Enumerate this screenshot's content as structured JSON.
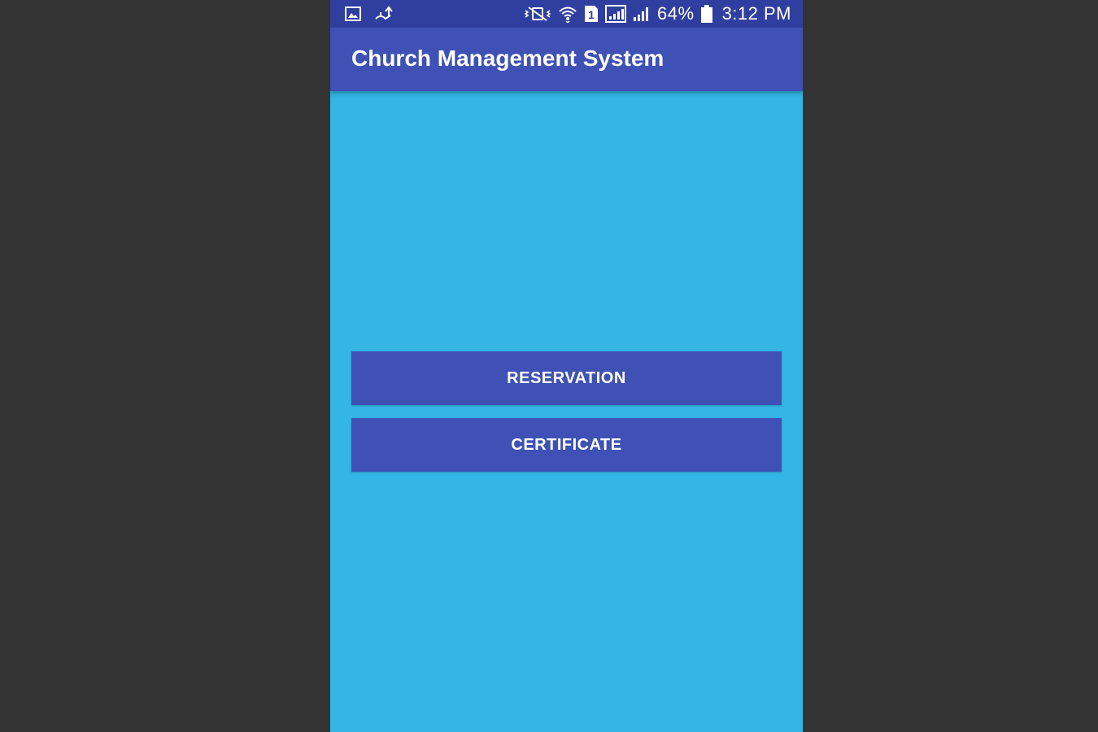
{
  "status_bar": {
    "icons_left": [
      "image-icon",
      "usb-upload-icon"
    ],
    "icons_right": [
      "vibrate-mute-icon",
      "wifi-icon",
      "sim1-icon",
      "signal-sim1-icon",
      "signal-sim2-icon",
      "battery-icon"
    ],
    "battery_percent": "64%",
    "time": "3:12 PM"
  },
  "app_bar": {
    "title": "Church Management System"
  },
  "main": {
    "buttons": [
      {
        "label": "RESERVATION"
      },
      {
        "label": "CERTIFICATE"
      }
    ]
  },
  "colors": {
    "status_bar": "#303f9f",
    "primary": "#3f51b5",
    "background": "#33b5e5",
    "backdrop": "#333333",
    "text_on_primary": "#ffffff"
  }
}
